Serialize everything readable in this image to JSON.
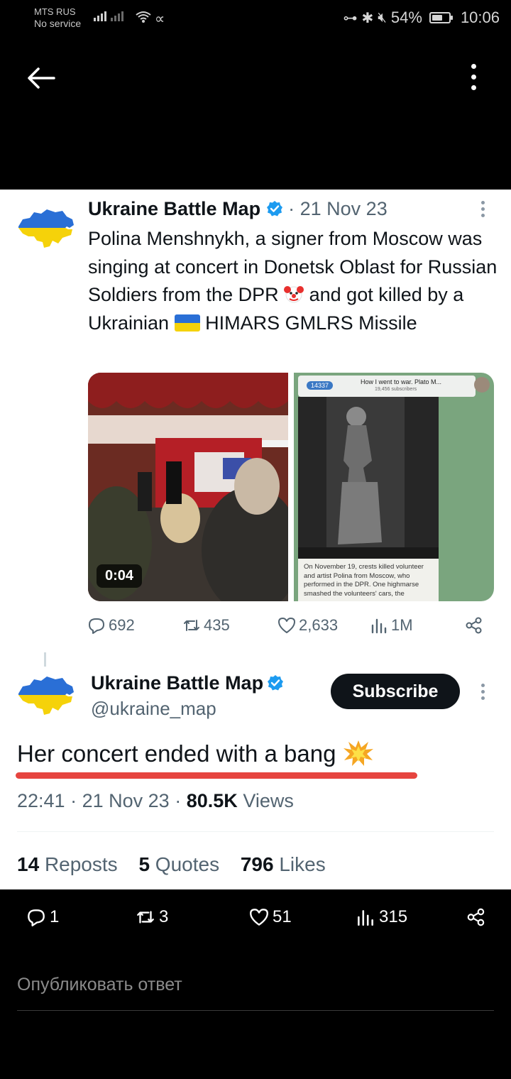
{
  "status_bar": {
    "carrier": "MTS RUS",
    "service": "No service",
    "battery": "54%",
    "battery_level": 0.54,
    "time": "10:06"
  },
  "quoted_tweet": {
    "name": "Ukraine Battle Map",
    "separator": "·",
    "date": "21 Nov 23",
    "text_part1": "Polina Menshnykh, a signer from Moscow was singing at concert in Donetsk Oblast for Russian Soldiers from the DPR",
    "text_part2": "and got killed by a Ukrainian",
    "text_part3": "HIMARS GMLRS Missile",
    "video_duration": "0:04",
    "telegram": {
      "back_count": "14337",
      "title": "How I went to war. Plato M...",
      "subtitle": "19,456 subscribers",
      "caption": "On November 19, crests killed volunteer and artist Polina from Moscow, who performed in the DPR. One highmarse smashed the volunteers' cars, the"
    },
    "stats": {
      "replies": "692",
      "reposts": "435",
      "likes": "2,633",
      "views": "1M"
    }
  },
  "main_tweet": {
    "name": "Ukraine Battle Map",
    "handle": "@ukraine_map",
    "subscribe_label": "Subscribe",
    "text": "Her concert ended with a bang",
    "time": "22:41",
    "dot": "·",
    "date": "21 Nov 23",
    "views_count": "80.5K",
    "views_label": "Views",
    "reposts_count": "14",
    "reposts_label": "Reposts",
    "quotes_count": "5",
    "quotes_label": "Quotes",
    "likes_count": "796",
    "likes_label": "Likes"
  },
  "bottom_bar": {
    "replies": "1",
    "reposts": "3",
    "likes": "51",
    "views": "315",
    "reply_placeholder": "Опубликовать ответ"
  },
  "colors": {
    "accent_blue": "#1d9bf0",
    "underline_red": "#e6453f",
    "flag_blue": "#2a6fd6",
    "flag_yellow": "#f5d20a"
  }
}
